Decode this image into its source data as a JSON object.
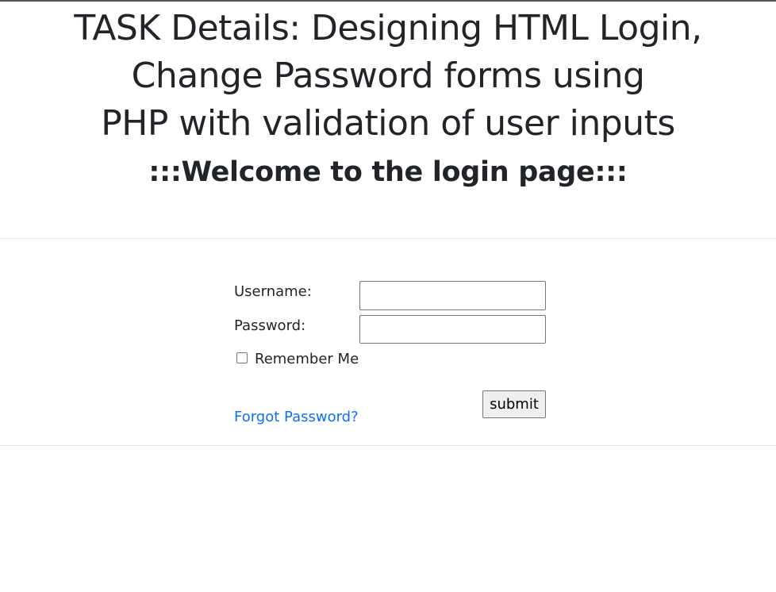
{
  "header": {
    "title_line1": "TASK Details: Designing HTML Login,",
    "title_line2": "Change Password forms using",
    "title_line3": "PHP with validation of user inputs",
    "subtitle": ":::Welcome to the login page:::"
  },
  "form": {
    "username_label": "Username:",
    "username_value": "",
    "password_label": "Password:",
    "password_value": "",
    "remember_label": "Remember Me",
    "remember_checked": false,
    "submit_label": "submit",
    "forgot_link": "Forgot Password?"
  }
}
